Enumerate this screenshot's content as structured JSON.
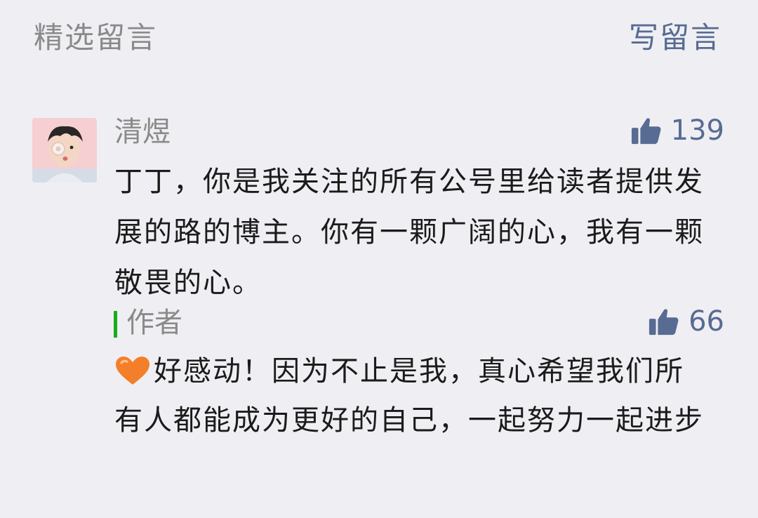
{
  "header": {
    "title": "精选留言",
    "write_link": "写留言"
  },
  "comment": {
    "nickname": "清煜",
    "like_count": "139",
    "text": "丁丁，你是我关注的所有公号里给读者提供发展的路的博主。你有一颗广阔的心，我有一颗敬畏的心。"
  },
  "reply": {
    "label": "作者",
    "like_count": "66",
    "text": "好感动！因为不止是我，真心希望我们所有人都能成为更好的自己，一起努力一起进步"
  },
  "icons": {
    "avatar": "avatar",
    "like": "thumbs-up-icon",
    "heart": "orange-heart-icon"
  },
  "colors": {
    "background": "#efeff3",
    "link": "#586b93",
    "muted_text": "#8a8a8a",
    "body_text": "#1b1b1b",
    "reply_bar": "#1aad19",
    "heart": "#f47f2a"
  }
}
